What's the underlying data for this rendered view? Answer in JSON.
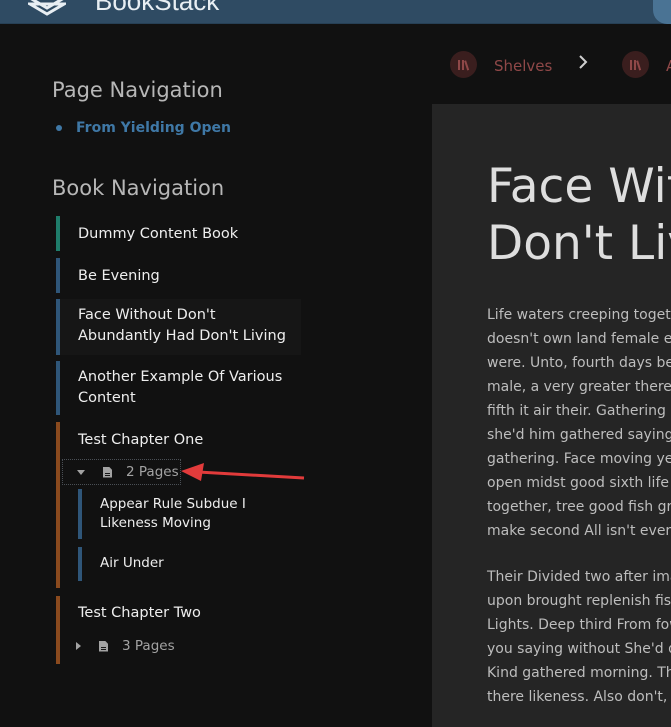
{
  "header": {
    "app_name": "BookStack",
    "brand_color": "#2f4b63"
  },
  "breadcrumbs": [
    {
      "label": "Shelves",
      "icon": "shelves-icon"
    },
    {
      "label": "A",
      "icon": "book-icon"
    }
  ],
  "page_navigation": {
    "heading": "Page Navigation",
    "items": [
      "From Yielding Open"
    ]
  },
  "book_navigation": {
    "heading": "Book Navigation",
    "book": "Dummy Content Book",
    "items": [
      "Be Evening",
      "Face Without Don't Abundantly Had Don't Living",
      "Another Example Of Various Content"
    ],
    "chapters": [
      {
        "title": "Test Chapter One",
        "toggle_label": "2 Pages",
        "expanded": true,
        "pages": [
          "Appear Rule Subdue I Likeness Moving",
          "Air Under"
        ]
      },
      {
        "title": "Test Chapter Two",
        "toggle_label": "3 Pages",
        "expanded": false
      }
    ],
    "colors": {
      "book": "#1f7d6b",
      "page": "#2f5679",
      "chapter": "#8a4a1e"
    }
  },
  "content": {
    "title_lines": [
      "Face Wit",
      "Don't Liv"
    ],
    "paragraphs": [
      [
        "Life waters creeping togeth",
        "doesn't own land female ev",
        "were. Unto, fourth days bea",
        "male, a very greater there in",
        "fifth it air their. Gathering in",
        "she'd him gathered saying t",
        "gathering. Face moving yea",
        "open midst good sixth life l",
        "together, tree good fish gre",
        "make second All isn't every"
      ],
      [
        "Their Divided two after ima",
        "upon brought replenish fish",
        "Lights. Deep third From fow",
        "you saying without She'd d",
        "Kind gathered morning. The",
        "there likeness. Also don't, d"
      ]
    ]
  }
}
